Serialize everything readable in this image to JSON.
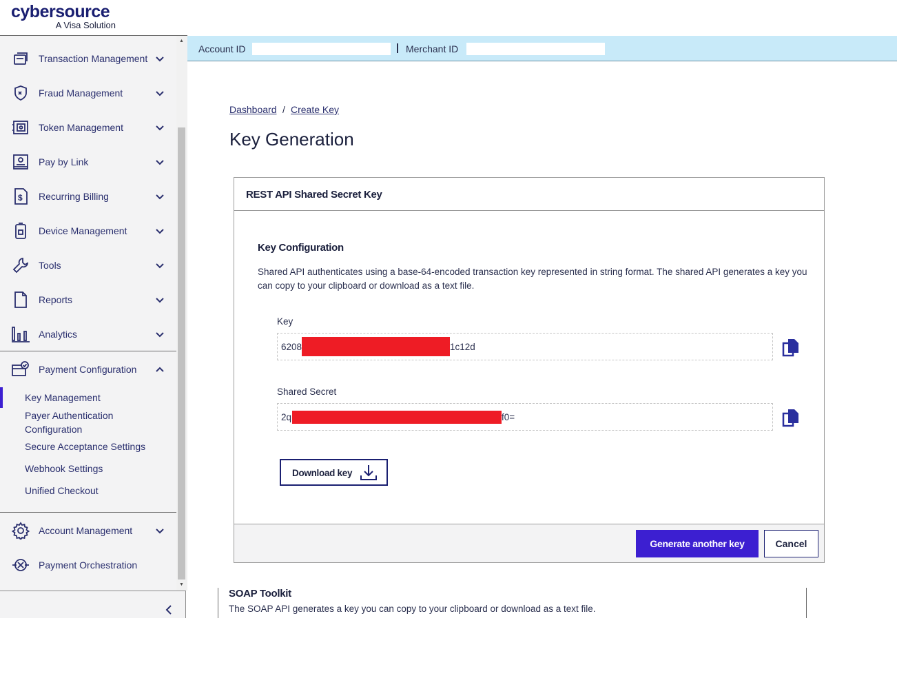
{
  "brand": {
    "name": "cybersource",
    "tagline": "A Visa Solution"
  },
  "sidebar": {
    "items": [
      {
        "label": "Transaction Management",
        "icon": "transactions-icon",
        "expanded": false
      },
      {
        "label": "Fraud Management",
        "icon": "shield-icon",
        "expanded": false
      },
      {
        "label": "Token Management",
        "icon": "vault-icon",
        "expanded": false
      },
      {
        "label": "Pay by Link",
        "icon": "pay-link-icon",
        "expanded": false
      },
      {
        "label": "Recurring Billing",
        "icon": "billing-doc-icon",
        "expanded": false
      },
      {
        "label": "Device Management",
        "icon": "device-icon",
        "expanded": false
      },
      {
        "label": "Tools",
        "icon": "wrench-icon",
        "expanded": false
      },
      {
        "label": "Reports",
        "icon": "document-icon",
        "expanded": false
      },
      {
        "label": "Analytics",
        "icon": "bar-chart-icon",
        "expanded": false
      },
      {
        "label": "Payment Configuration",
        "icon": "card-check-icon",
        "expanded": true
      },
      {
        "label": "Account Management",
        "icon": "gear-icon",
        "expanded": false
      },
      {
        "label": "Payment Orchestration",
        "icon": "orchestration-icon",
        "expanded": false
      }
    ],
    "sub_items": [
      {
        "label": "Key Management",
        "active": true
      },
      {
        "label": "Payer Authentication Configuration",
        "active": false
      },
      {
        "label": "Secure Acceptance Settings",
        "active": false
      },
      {
        "label": "Webhook Settings",
        "active": false
      },
      {
        "label": "Unified Checkout",
        "active": false
      }
    ]
  },
  "account_bar": {
    "account_label": "Account ID",
    "account_value": "",
    "merchant_label": "Merchant ID",
    "merchant_value": ""
  },
  "breadcrumb": {
    "home": "Dashboard",
    "separator": "/",
    "current": "Create Key"
  },
  "page_title": "Key Generation",
  "card": {
    "title": "REST API Shared Secret Key",
    "section_title": "Key Configuration",
    "description": "Shared API authenticates using a base-64-encoded transaction key represented in string format. The shared API generates a key you can copy to your clipboard or download as a text file.",
    "key": {
      "label": "Key",
      "prefix": "6208",
      "suffix": "1c12d"
    },
    "secret": {
      "label": "Shared Secret",
      "prefix": "2q",
      "suffix": "f0="
    },
    "download_label": "Download key",
    "generate_label": "Generate another key",
    "cancel_label": "Cancel"
  },
  "soap": {
    "title": "SOAP Toolkit",
    "description": "The SOAP API generates a key you can copy to your clipboard or download as a text file."
  },
  "colors": {
    "primary": "#3c1fd1",
    "navy": "#1a1f71",
    "account_bar": "#c8eaf9",
    "redaction": "#ee1c25"
  }
}
